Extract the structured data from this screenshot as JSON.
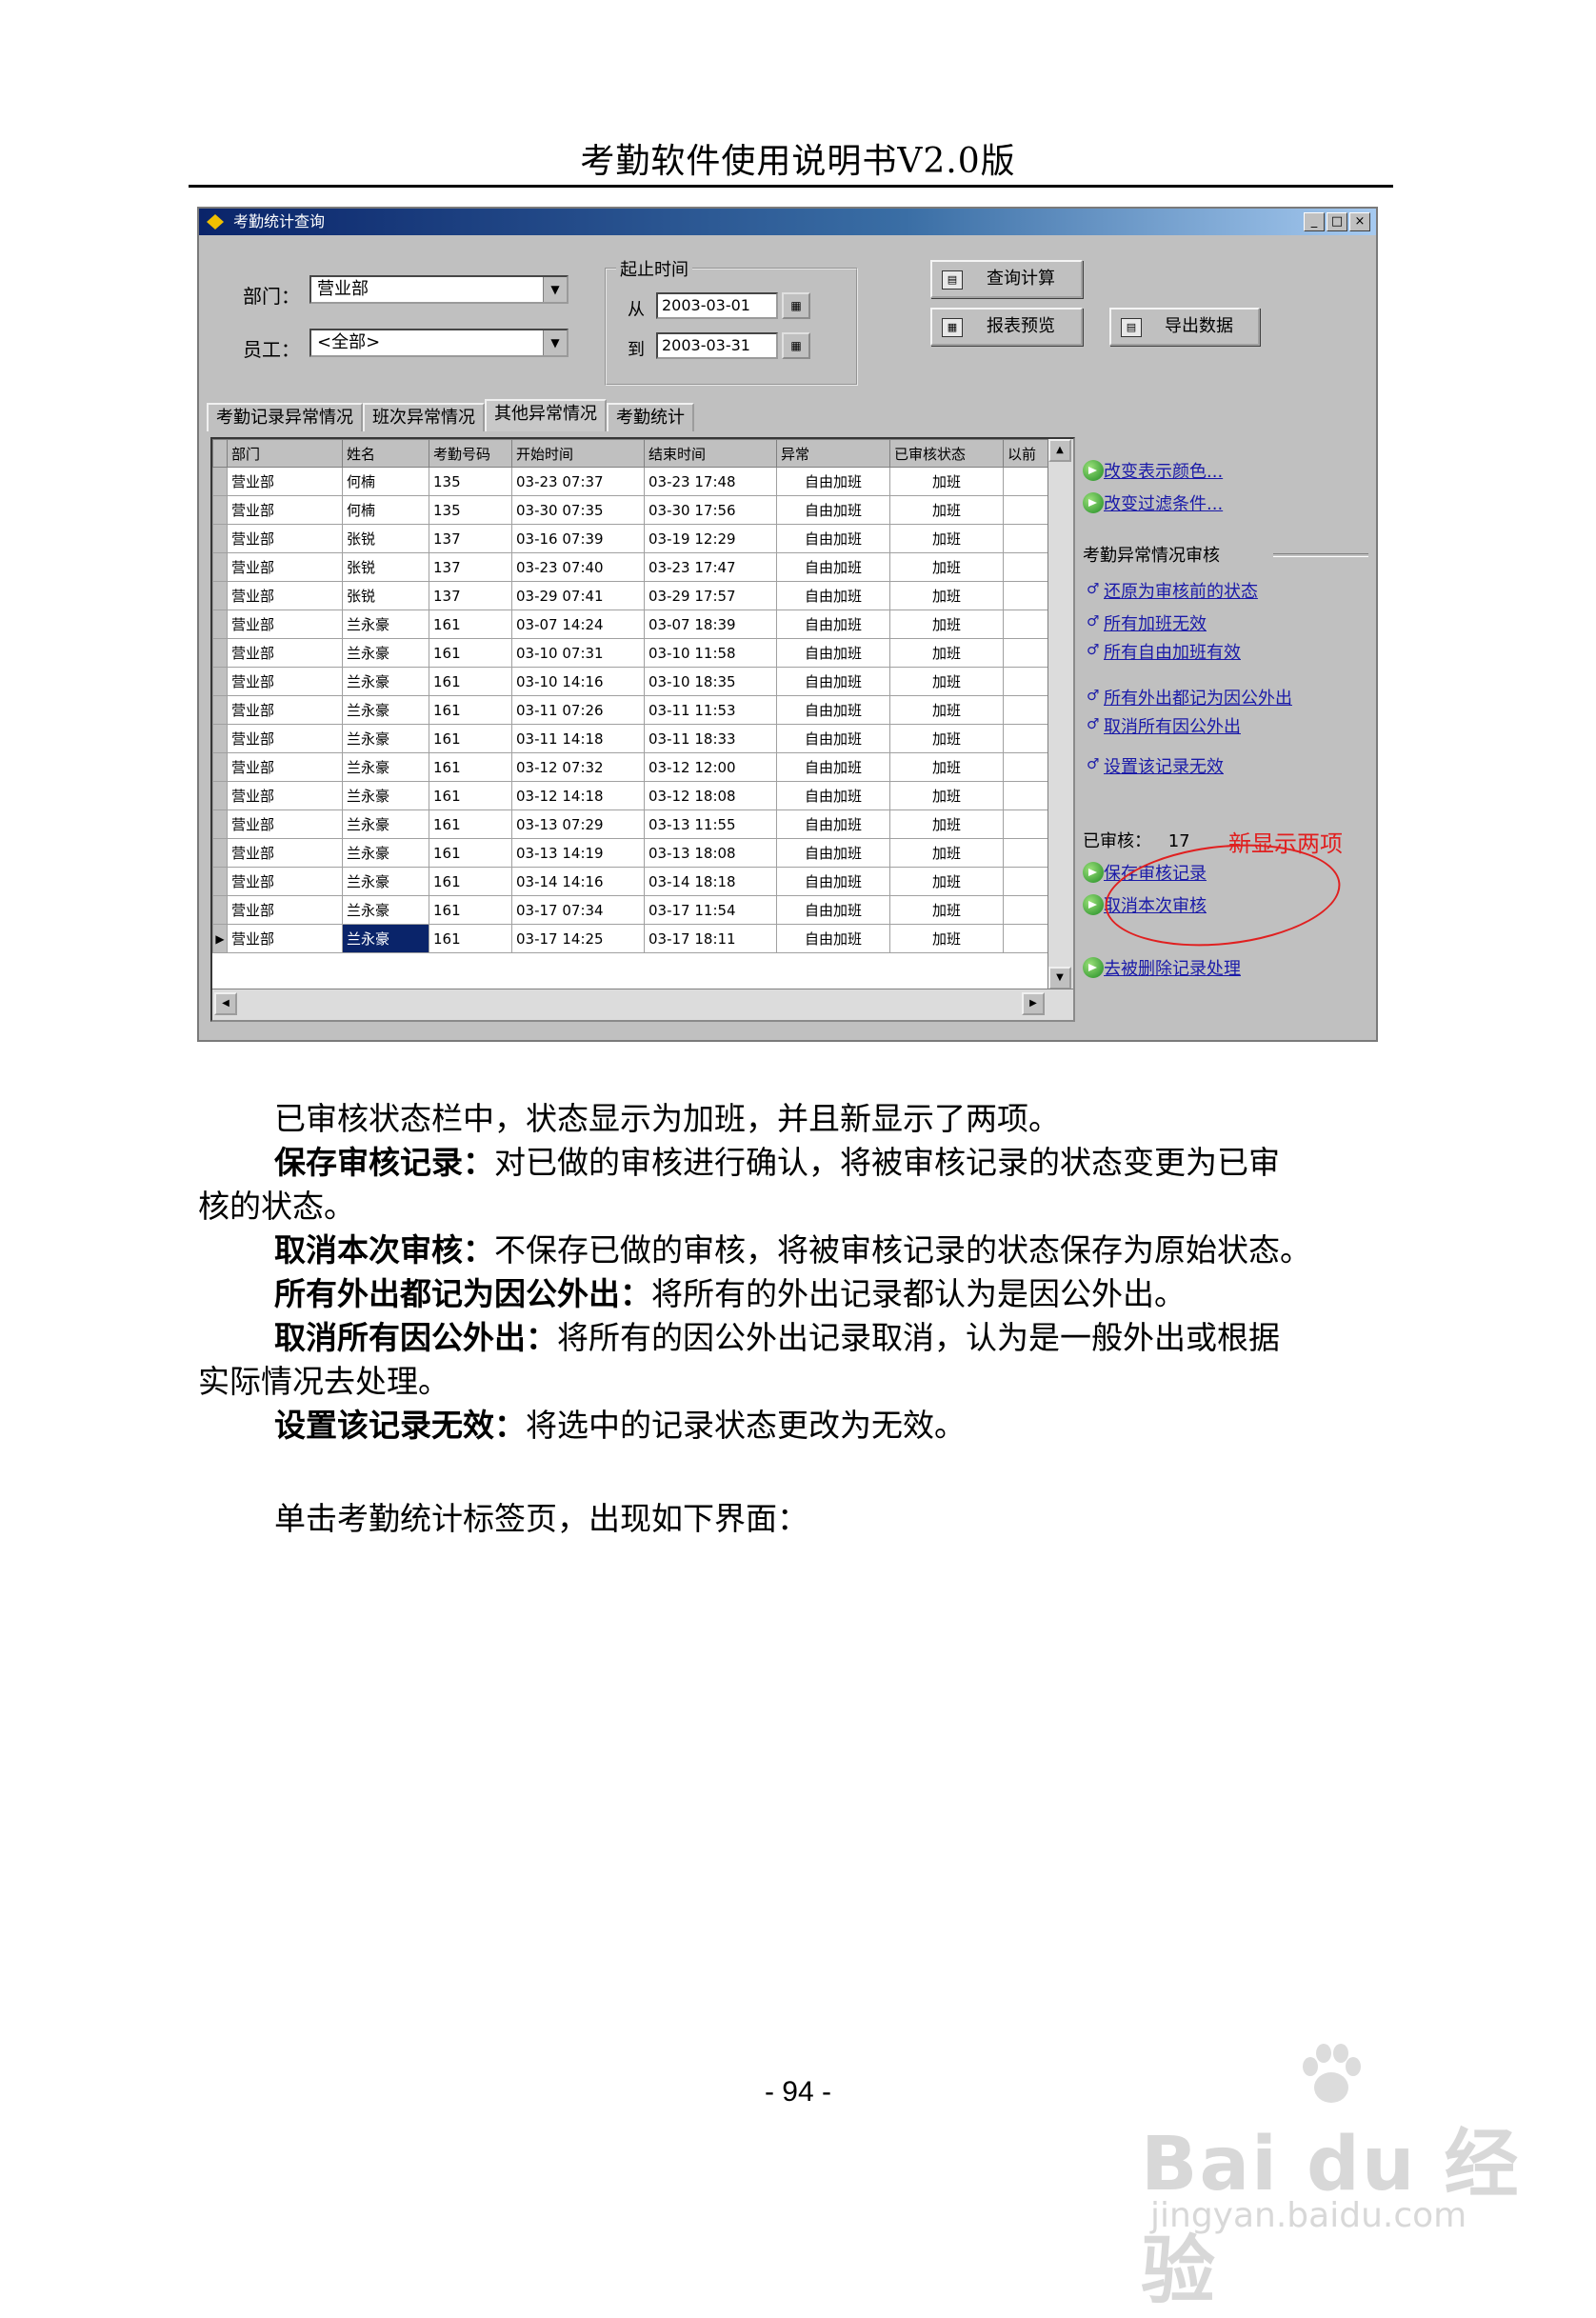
{
  "doc": {
    "header_title": "考勤软件使用说明书V2.0版",
    "page_number": "- 94 -"
  },
  "window": {
    "title": "考勤统计查询",
    "controls": {
      "minimize": "_",
      "maximize": "□",
      "close": "×"
    },
    "dept_label": "部门：",
    "dept_value": "营业部",
    "emp_label": "员工：",
    "emp_value": "<全部>",
    "period_title": "起止时间",
    "from_label": "从",
    "from_value": "2003-03-01",
    "to_label": "到",
    "to_value": "2003-03-31",
    "buttons": {
      "query": "查询计算",
      "report": "报表预览",
      "export": "导出数据"
    },
    "tabs": [
      "考勤记录异常情况",
      "班次异常情况",
      "其他异常情况",
      "考勤统计"
    ],
    "active_tab": 2,
    "grid": {
      "columns": [
        "部门",
        "姓名",
        "考勤号码",
        "开始时间",
        "结束时间",
        "异常",
        "已审核状态",
        "以前"
      ],
      "rows": [
        [
          "营业部",
          "何楠",
          "135",
          "03-23 07:37",
          "03-23 17:48",
          "自由加班",
          "加班"
        ],
        [
          "营业部",
          "何楠",
          "135",
          "03-30 07:35",
          "03-30 17:56",
          "自由加班",
          "加班"
        ],
        [
          "营业部",
          "张锐",
          "137",
          "03-16 07:39",
          "03-19 12:29",
          "自由加班",
          "加班"
        ],
        [
          "营业部",
          "张锐",
          "137",
          "03-23 07:40",
          "03-23 17:47",
          "自由加班",
          "加班"
        ],
        [
          "营业部",
          "张锐",
          "137",
          "03-29 07:41",
          "03-29 17:57",
          "自由加班",
          "加班"
        ],
        [
          "营业部",
          "兰永豪",
          "161",
          "03-07 14:24",
          "03-07 18:39",
          "自由加班",
          "加班"
        ],
        [
          "营业部",
          "兰永豪",
          "161",
          "03-10 07:31",
          "03-10 11:58",
          "自由加班",
          "加班"
        ],
        [
          "营业部",
          "兰永豪",
          "161",
          "03-10 14:16",
          "03-10 18:35",
          "自由加班",
          "加班"
        ],
        [
          "营业部",
          "兰永豪",
          "161",
          "03-11 07:26",
          "03-11 11:53",
          "自由加班",
          "加班"
        ],
        [
          "营业部",
          "兰永豪",
          "161",
          "03-11 14:18",
          "03-11 18:33",
          "自由加班",
          "加班"
        ],
        [
          "营业部",
          "兰永豪",
          "161",
          "03-12 07:32",
          "03-12 12:00",
          "自由加班",
          "加班"
        ],
        [
          "营业部",
          "兰永豪",
          "161",
          "03-12 14:18",
          "03-12 18:08",
          "自由加班",
          "加班"
        ],
        [
          "营业部",
          "兰永豪",
          "161",
          "03-13 07:29",
          "03-13 11:55",
          "自由加班",
          "加班"
        ],
        [
          "营业部",
          "兰永豪",
          "161",
          "03-13 14:19",
          "03-13 18:08",
          "自由加班",
          "加班"
        ],
        [
          "营业部",
          "兰永豪",
          "161",
          "03-14 14:16",
          "03-14 18:18",
          "自由加班",
          "加班"
        ],
        [
          "营业部",
          "兰永豪",
          "161",
          "03-17 07:34",
          "03-17 11:54",
          "自由加班",
          "加班"
        ],
        [
          "营业部",
          "兰永豪",
          "161",
          "03-17 14:25",
          "03-17 18:11",
          "自由加班",
          "加班"
        ]
      ],
      "current_row_marker": "▶"
    },
    "side": {
      "top_links": [
        "改变表示颜色...",
        "改变过滤条件..."
      ],
      "section_title": "考勤异常情况审核",
      "audit_links": [
        "还原为审核前的状态",
        "所有加班无效",
        "所有自由加班有效",
        "所有外出都记为因公外出",
        "取消所有因公外出",
        "设置该记录无效"
      ],
      "audited_label": "已审核：",
      "audited_count": "17",
      "new_links": [
        "保存审核记录",
        "取消本次审核"
      ],
      "bottom_link": "去被删除记录处理"
    },
    "annotation": "新显示两项"
  },
  "body": {
    "p1": "已审核状态栏中，状态显示为加班，并且新显示了两项。",
    "p2_bold": "保存审核记录：",
    "p2_text": "对已做的审核进行确认，将被审核记录的状态变更为已审",
    "p2_cont": "核的状态。",
    "p3_bold": "取消本次审核：",
    "p3_text": "不保存已做的审核，将被审核记录的状态保存为原始状态。",
    "p4_bold": "所有外出都记为因公外出：",
    "p4_text": "将所有的外出记录都认为是因公外出。",
    "p5_bold": "取消所有因公外出：",
    "p5_text": "将所有的因公外出记录取消，认为是一般外出或根据",
    "p5_cont": "实际情况去处理。",
    "p6_bold": "设置该记录无效：",
    "p6_text": "将选中的记录状态更改为无效。",
    "p7": "单击考勤统计标签页，出现如下界面："
  },
  "watermark": {
    "brand": "Bai du 经验",
    "url": "jingyan.baidu.com"
  }
}
